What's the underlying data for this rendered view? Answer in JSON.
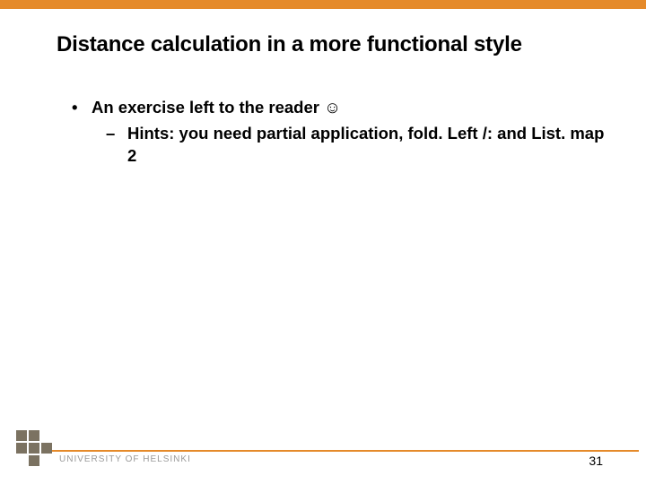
{
  "slide": {
    "title": "Distance calculation in a more functional style",
    "bullets": [
      {
        "marker": "•",
        "text": "An exercise left to the reader ☺",
        "children": [
          {
            "marker": "–",
            "text": "Hints: you need partial application, fold. Left /: and List. map 2"
          }
        ]
      }
    ],
    "page_number": "31",
    "footer_institution": "UNIVERSITY OF HELSINKI"
  }
}
